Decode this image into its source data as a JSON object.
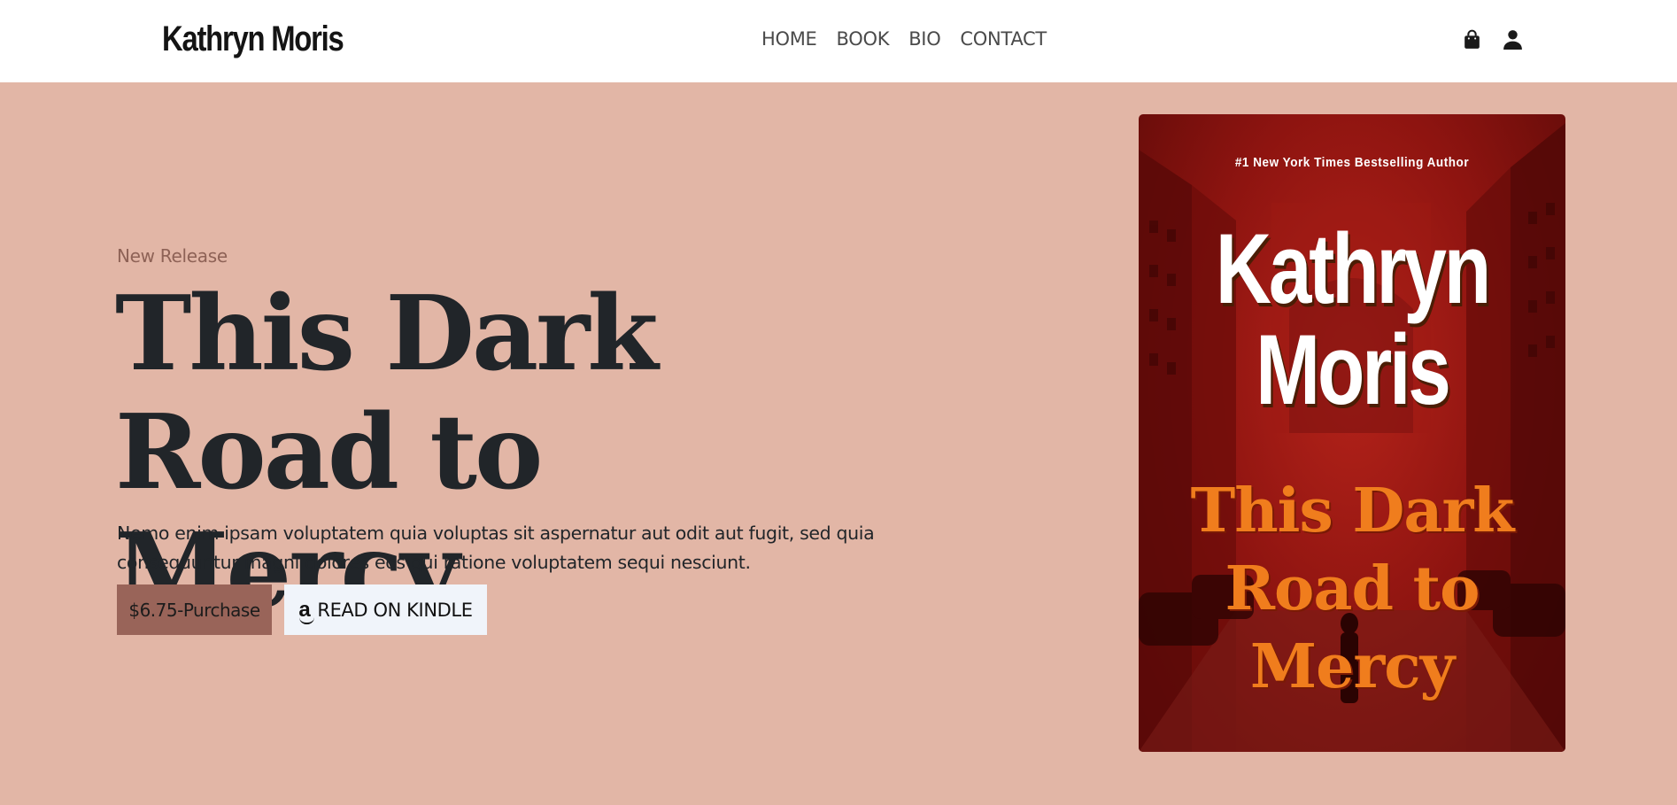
{
  "header": {
    "logo": "Kathryn Moris",
    "nav": [
      "HOME",
      "BOOK",
      "BIO",
      "CONTACT"
    ],
    "icons": [
      "shopping-bag-icon",
      "user-icon"
    ]
  },
  "hero": {
    "eyebrow": "New Release",
    "title_line1": "This Dark",
    "title_line2": "Road to Mercy",
    "description": "Nemo enim ipsam voluptatem quia voluptas sit aspernatur aut odit aut fugit, sed quia consequuntur magni dolores eos qui ratione voluptatem sequi nesciunt.",
    "purchase_label": "$6.75-Purchase",
    "kindle_label": "READ ON KINDLE",
    "kindle_icon": "amazon-icon"
  },
  "cover": {
    "tagline": "#1 New York Times Bestselling Author",
    "author_line1": "Kathryn",
    "author_line2": "Moris",
    "title_line1": "This Dark",
    "title_line2": "Road to",
    "title_line3": "Mercy"
  },
  "colors": {
    "page_background": "#e2b6a6",
    "header_background": "#ffffff",
    "eyebrow": "#8e6256",
    "purchase_button": "#996459",
    "kindle_button": "#f0f4fa",
    "cover_red": "#8e1410",
    "cover_title_orange": "#f07d1d"
  }
}
